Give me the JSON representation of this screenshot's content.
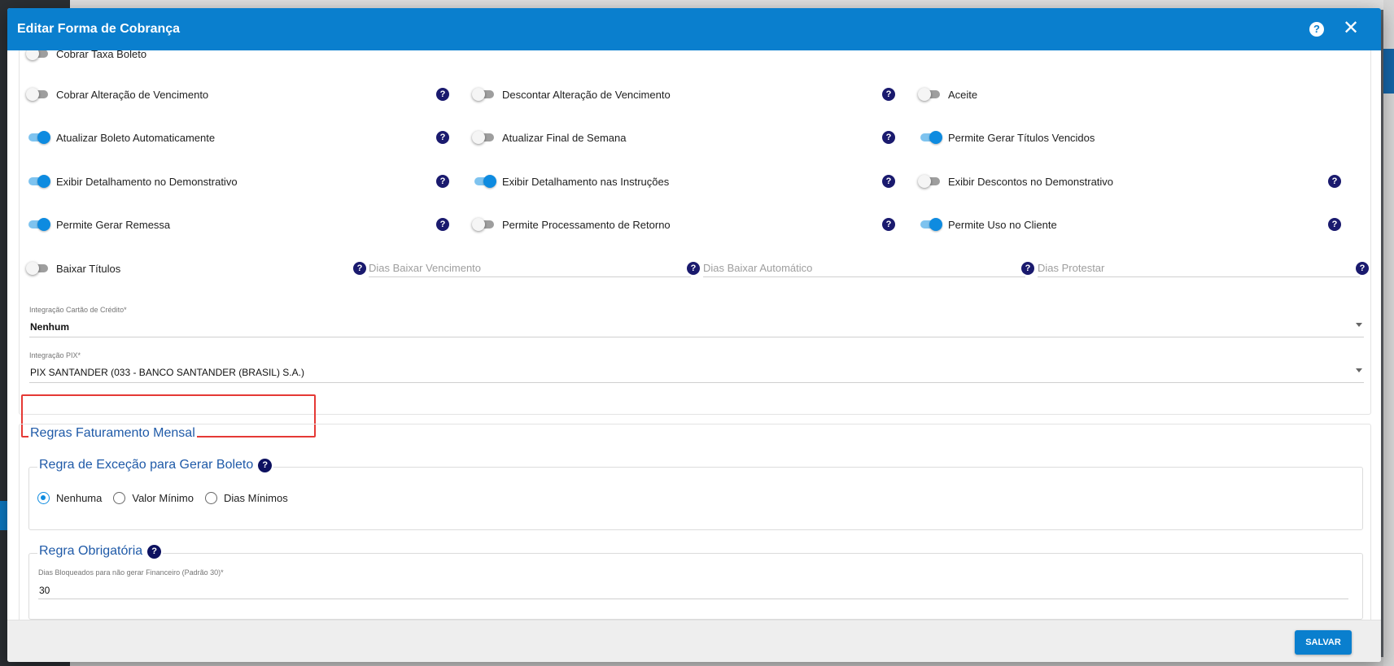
{
  "dialog": {
    "title": "Editar Forma de Cobrança",
    "help_icon": "question-circle-icon",
    "close_icon": "close-icon"
  },
  "toggles": {
    "cobrar_taxa_boleto": {
      "label": "Cobrar Taxa Boleto",
      "on": false
    },
    "cobrar_alteracao_vencimento": {
      "label": "Cobrar Alteração de Vencimento",
      "on": false
    },
    "descontar_alteracao_vencimento": {
      "label": "Descontar Alteração de Vencimento",
      "on": false
    },
    "aceite": {
      "label": "Aceite",
      "on": false
    },
    "atualizar_boleto": {
      "label": "Atualizar Boleto Automaticamente",
      "on": true
    },
    "atualizar_final_semana": {
      "label": "Atualizar Final de Semana",
      "on": false
    },
    "permite_gerar_titulos_vencidos": {
      "label": "Permite Gerar Títulos Vencidos",
      "on": true
    },
    "exibir_det_demonstrativo": {
      "label": "Exibir Detalhamento no Demonstrativo",
      "on": true
    },
    "exibir_det_instrucoes": {
      "label": "Exibir Detalhamento nas Instruções",
      "on": true
    },
    "exibir_descontos_demonstrativo": {
      "label": "Exibir Descontos no Demonstrativo",
      "on": false
    },
    "permite_gerar_remessa": {
      "label": "Permite Gerar Remessa",
      "on": true
    },
    "permite_processamento_retorno": {
      "label": "Permite Processamento de Retorno",
      "on": false
    },
    "permite_uso_cliente": {
      "label": "Permite Uso no Cliente",
      "on": true
    },
    "baixar_titulos": {
      "label": "Baixar Títulos",
      "on": false
    }
  },
  "inline_fields": {
    "dias_baixar_vencimento": {
      "placeholder": "Dias Baixar Vencimento"
    },
    "dias_baixar_automatico": {
      "placeholder": "Dias Baixar Automático"
    },
    "dias_protestar": {
      "placeholder": "Dias Protestar"
    }
  },
  "selects": {
    "integracao_cartao": {
      "label": "Integração Cartão de Crédito",
      "required": "*",
      "value": "Nenhum"
    },
    "integracao_pix": {
      "label": "Integração PIX",
      "required": "*",
      "value": "PIX SANTANDER (033 - BANCO SANTANDER (BRASIL) S.A.)"
    }
  },
  "regras": {
    "title": "Regras Faturamento Mensal",
    "excecao": {
      "title": "Regra de Exceção para Gerar Boleto",
      "options": [
        "Nenhuma",
        "Valor Mínimo",
        "Dias Mínimos"
      ],
      "selected": "Nenhuma"
    },
    "obrigatoria": {
      "title": "Regra Obrigatória",
      "field_label": "Dias Bloqueados para não gerar Financeiro (Padrão 30)",
      "required": "*",
      "field_value": "30"
    }
  },
  "footer": {
    "save_label": "SALVAR"
  },
  "colors": {
    "primary": "#0a7fce",
    "toggle_on": "#0e8be0",
    "help_icon": "#1a1a6e",
    "section_title": "#1f5aa8",
    "highlight": "#e53935"
  }
}
